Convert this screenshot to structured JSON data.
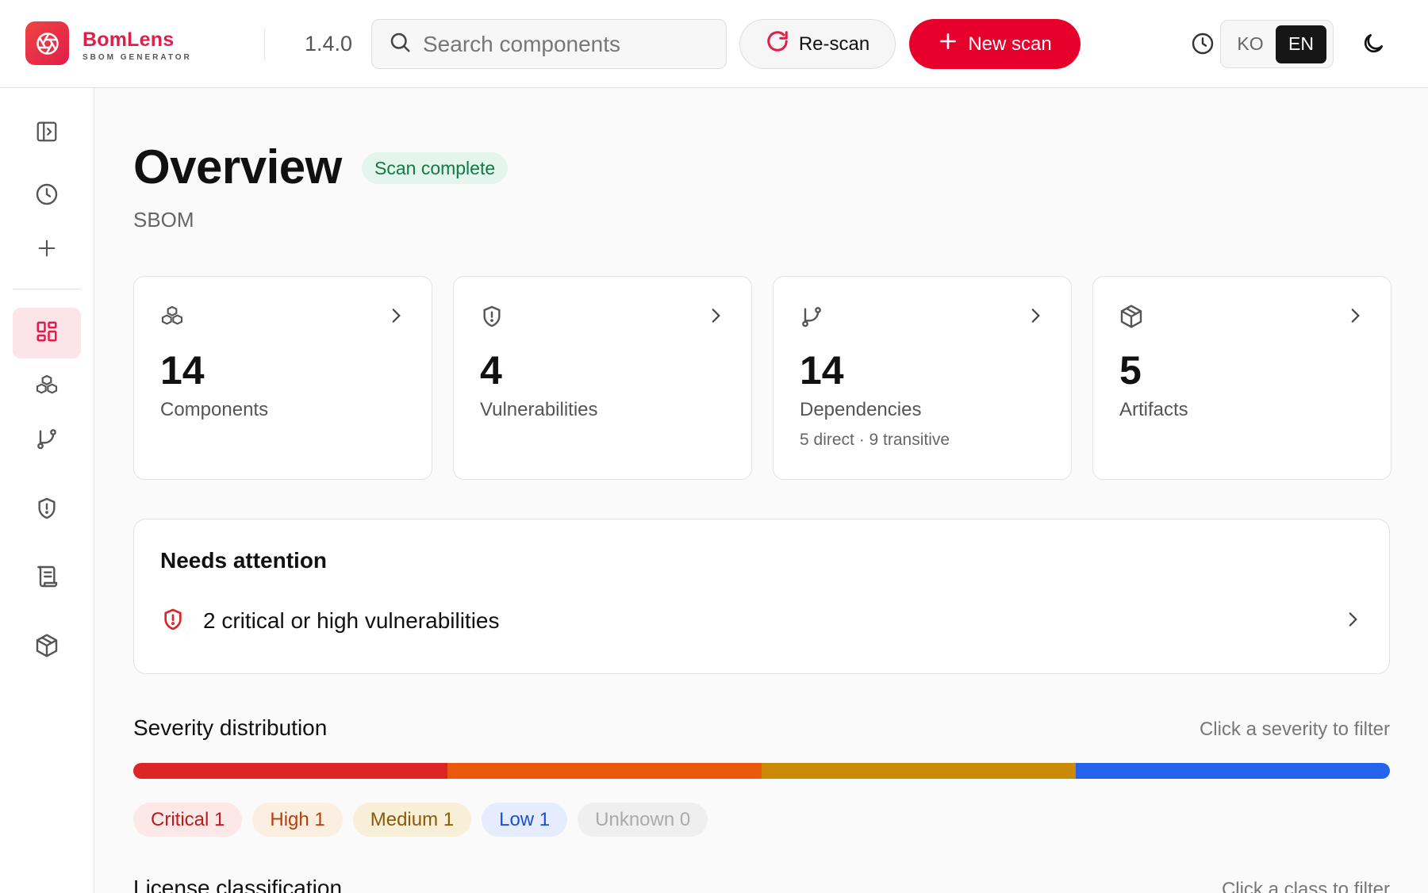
{
  "header": {
    "brand_name": "BomLens",
    "brand_sub": "SBOM GENERATOR",
    "version": "1.4.0",
    "search_placeholder": "Search components",
    "rescan_label": "Re-scan",
    "new_scan_label": "New scan",
    "lang_options": [
      "KO",
      "EN"
    ],
    "lang_active": "EN",
    "icons": [
      "logo-aperture-icon",
      "search-icon",
      "refresh-icon",
      "plus-icon",
      "history-icon",
      "help-icon",
      "moon-icon"
    ]
  },
  "sidebar": {
    "items": [
      {
        "name": "toggle-sidebar",
        "icon": "panel-expand-icon"
      },
      {
        "name": "history",
        "icon": "clock-icon"
      },
      {
        "name": "new-scan",
        "icon": "plus-icon"
      },
      {
        "name": "overview",
        "icon": "dashboard-icon",
        "active": true
      },
      {
        "name": "components",
        "icon": "boxes-icon"
      },
      {
        "name": "dependencies",
        "icon": "git-branch-icon"
      },
      {
        "name": "vulnerabilities",
        "icon": "shield-alert-icon"
      },
      {
        "name": "licenses",
        "icon": "scroll-icon"
      },
      {
        "name": "artifacts",
        "icon": "package-icon"
      }
    ]
  },
  "main": {
    "title": "Overview",
    "status": "Scan complete",
    "subtitle": "SBOM",
    "cards": [
      {
        "icon": "boxes-icon",
        "value": "14",
        "label": "Components",
        "extra": ""
      },
      {
        "icon": "shield-alert-icon",
        "value": "4",
        "label": "Vulnerabilities",
        "extra": ""
      },
      {
        "icon": "git-branch-icon",
        "value": "14",
        "label": "Dependencies",
        "extra": "5 direct · 9 transitive"
      },
      {
        "icon": "package-icon",
        "value": "5",
        "label": "Artifacts",
        "extra": ""
      }
    ],
    "attention": {
      "title": "Needs attention",
      "items": [
        {
          "icon": "shield-alert-icon",
          "text": "2 critical or high vulnerabilities"
        }
      ]
    },
    "severity": {
      "title": "Severity distribution",
      "hint": "Click a severity to filter",
      "levels": [
        {
          "label": "Critical 1",
          "count": 1,
          "color": "#dc2626",
          "bg": "#fde8e8",
          "fg": "#b91c1c"
        },
        {
          "label": "High 1",
          "count": 1,
          "color": "#ea580c",
          "bg": "#fdeee2",
          "fg": "#b4400c"
        },
        {
          "label": "Medium 1",
          "count": 1,
          "color": "#ca8a04",
          "bg": "#f8efd8",
          "fg": "#8a5a06"
        },
        {
          "label": "Low 1",
          "count": 1,
          "color": "#2563eb",
          "bg": "#e4ecfd",
          "fg": "#1d4ed8"
        },
        {
          "label": "Unknown 0",
          "count": 0,
          "color": "#9ca3af",
          "bg": "#efefef",
          "fg": "#aaaaaa"
        }
      ]
    },
    "license": {
      "title": "License classification",
      "hint": "Click a class to filter"
    }
  }
}
